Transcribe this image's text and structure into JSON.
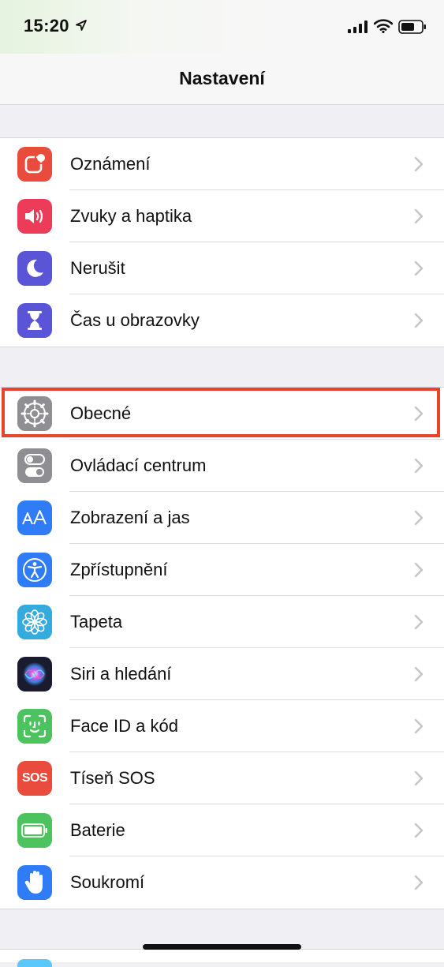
{
  "status_bar": {
    "time": "15:20"
  },
  "nav": {
    "title": "Nastavení"
  },
  "groups": [
    {
      "items": [
        {
          "label": "Oznámení",
          "icon": "notifications-icon",
          "color": "#e94c3d"
        },
        {
          "label": "Zvuky a haptika",
          "icon": "speaker-icon",
          "color": "#ec3c5a"
        },
        {
          "label": "Nerušit",
          "icon": "moon-icon",
          "color": "#5a54d6"
        },
        {
          "label": "Čas u obrazovky",
          "icon": "hourglass-icon",
          "color": "#5a54d6"
        }
      ]
    },
    {
      "items": [
        {
          "label": "Obecné",
          "icon": "gear-icon",
          "color": "#8e8e93"
        },
        {
          "label": "Ovládací centrum",
          "icon": "toggles-icon",
          "color": "#8e8e93"
        },
        {
          "label": "Zobrazení a jas",
          "icon": "text-size-icon",
          "color": "#2f7cf6"
        },
        {
          "label": "Zpřístupnění",
          "icon": "accessibility-icon",
          "color": "#2f7cf6"
        },
        {
          "label": "Tapeta",
          "icon": "flower-icon",
          "color": "#35aadc"
        },
        {
          "label": "Siri a hledání",
          "icon": "siri-icon",
          "color": "#1b1b2f"
        },
        {
          "label": "Face ID a kód",
          "icon": "face-id-icon",
          "color": "#4cc35e"
        },
        {
          "label": "Tíseň SOS",
          "icon_text": "SOS",
          "icon": "sos-icon",
          "color": "#e94c3d"
        },
        {
          "label": "Baterie",
          "icon": "battery-icon",
          "color": "#4cc35e"
        },
        {
          "label": "Soukromí",
          "icon": "hand-icon",
          "color": "#2f7cf6"
        }
      ]
    }
  ],
  "highlight_color": "#e8432b"
}
